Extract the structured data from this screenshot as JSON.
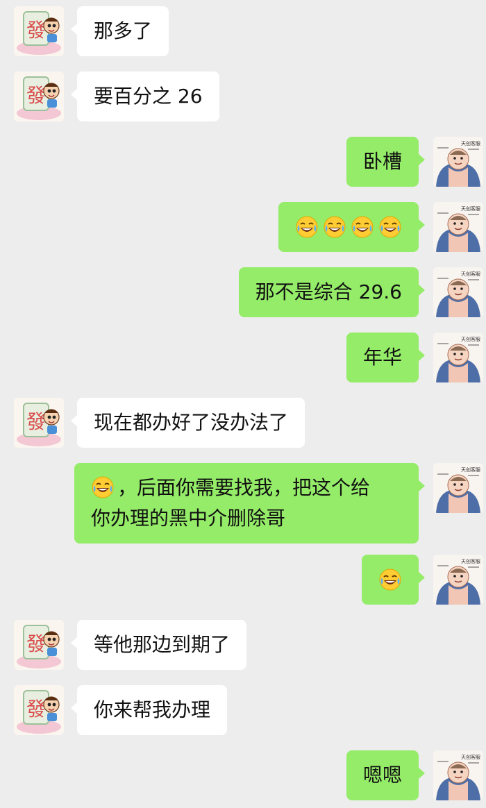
{
  "colors": {
    "background": "#ededed",
    "incoming_bubble": "#ffffff",
    "outgoing_bubble": "#95ec69"
  },
  "contacts": {
    "other_avatar": {
      "icon": "mahjong-fa-tile-avatar-icon",
      "seal_char": "發"
    },
    "self_avatar": {
      "icon": "cartoon-man-avatar-icon",
      "caption": "天创客服"
    }
  },
  "messages": [
    {
      "from": "other",
      "text": "那多了"
    },
    {
      "from": "other",
      "text": "要百分之 26"
    },
    {
      "from": "self",
      "text": "卧槽"
    },
    {
      "from": "self",
      "emojis": [
        "laugh-cry-emoji",
        "laugh-cry-emoji",
        "laugh-cry-emoji",
        "laugh-cry-emoji"
      ]
    },
    {
      "from": "self",
      "text": "那不是综合 29.6"
    },
    {
      "from": "self",
      "text": "年华"
    },
    {
      "from": "other",
      "text": "现在都办好了没办法了"
    },
    {
      "from": "self",
      "emoji": "laugh-cry-emoji",
      "line1": "，后面你需要找我，把这个给",
      "line2": "你办理的黑中介删除哥"
    },
    {
      "from": "self",
      "emojis": [
        "laugh-cry-emoji"
      ]
    },
    {
      "from": "other",
      "text": "等他那边到期了"
    },
    {
      "from": "other",
      "text": "你来帮我办理"
    },
    {
      "from": "self",
      "text": "嗯嗯"
    }
  ]
}
